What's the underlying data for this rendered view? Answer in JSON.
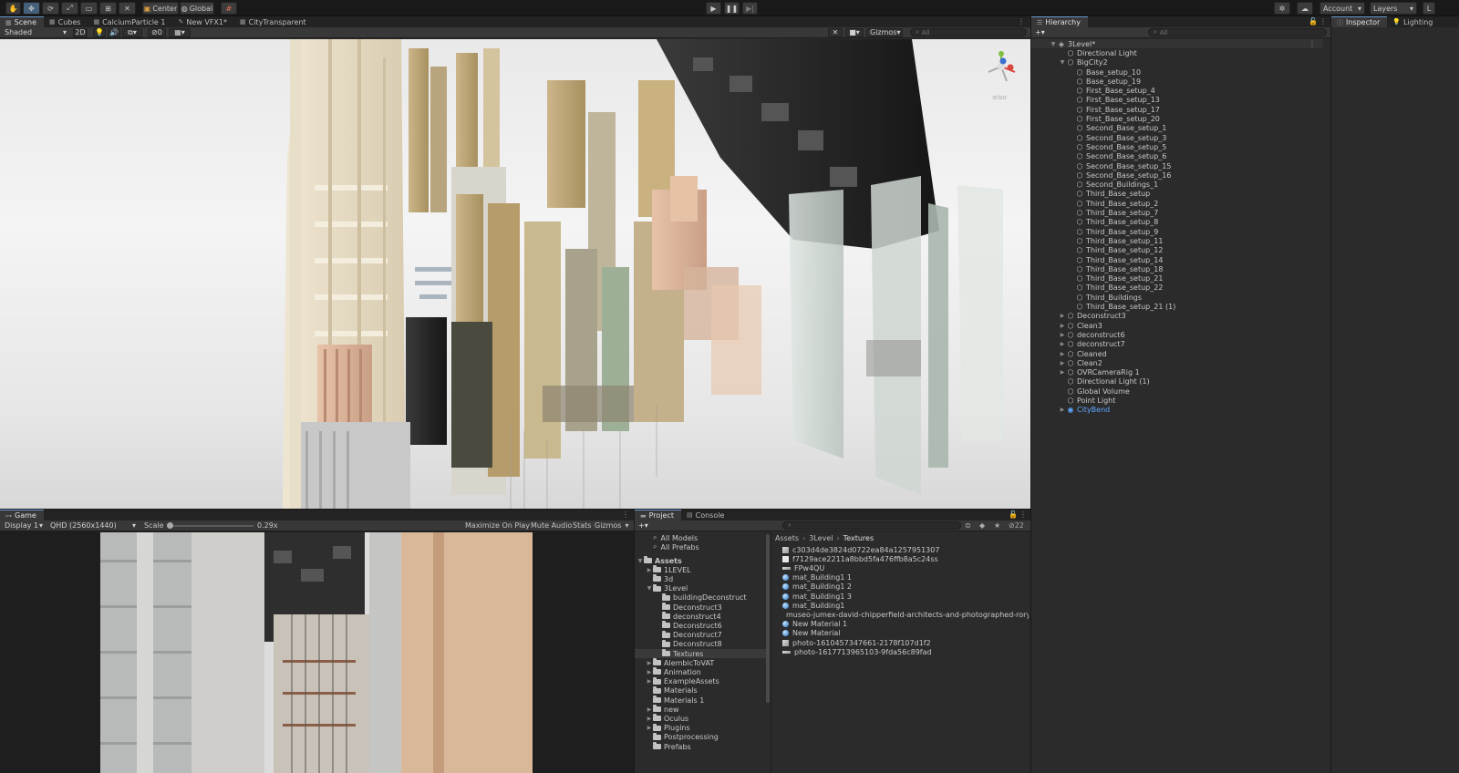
{
  "toolbar": {
    "center_label": "Center",
    "global_label": "Global",
    "account_label": "Account",
    "layers_label": "Layers"
  },
  "scene": {
    "tabs": [
      {
        "label": "Scene"
      },
      {
        "label": "Cubes"
      },
      {
        "label": "CalciumParticle 1"
      },
      {
        "label": "New VFX1*"
      },
      {
        "label": "CityTransparent"
      }
    ],
    "shading": "Shaded",
    "mode_2d": "2D",
    "gizmos": "Gizmos",
    "search_placeholder": "All",
    "fx_count": "0",
    "persp_label": "≡Iso"
  },
  "game": {
    "tab": "Game",
    "display": "Display 1",
    "resolution": "QHD (2560x1440)",
    "scale_label": "Scale",
    "scale_value": "0.29x",
    "maximize": "Maximize On Play",
    "mute": "Mute Audio",
    "stats": "Stats",
    "gizmos": "Gizmos"
  },
  "hierarchy": {
    "tab": "Hierarchy",
    "search_placeholder": "All",
    "root": "3Level*",
    "items": [
      {
        "label": "Directional Light",
        "indent": 1
      },
      {
        "label": "BigCity2",
        "indent": 1,
        "expanded": true
      },
      {
        "label": "Base_setup_10",
        "indent": 2
      },
      {
        "label": "Base_setup_19",
        "indent": 2
      },
      {
        "label": "First_Base_setup_4",
        "indent": 2
      },
      {
        "label": "First_Base_setup_13",
        "indent": 2
      },
      {
        "label": "First_Base_setup_17",
        "indent": 2
      },
      {
        "label": "First_Base_setup_20",
        "indent": 2
      },
      {
        "label": "Second_Base_setup_1",
        "indent": 2
      },
      {
        "label": "Second_Base_setup_3",
        "indent": 2
      },
      {
        "label": "Second_Base_setup_5",
        "indent": 2
      },
      {
        "label": "Second_Base_setup_6",
        "indent": 2
      },
      {
        "label": "Second_Base_setup_15",
        "indent": 2
      },
      {
        "label": "Second_Base_setup_16",
        "indent": 2
      },
      {
        "label": "Second_Buildings_1",
        "indent": 2
      },
      {
        "label": "Third_Base_setup",
        "indent": 2
      },
      {
        "label": "Third_Base_setup_2",
        "indent": 2
      },
      {
        "label": "Third_Base_setup_7",
        "indent": 2
      },
      {
        "label": "Third_Base_setup_8",
        "indent": 2
      },
      {
        "label": "Third_Base_setup_9",
        "indent": 2
      },
      {
        "label": "Third_Base_setup_11",
        "indent": 2
      },
      {
        "label": "Third_Base_setup_12",
        "indent": 2
      },
      {
        "label": "Third_Base_setup_14",
        "indent": 2
      },
      {
        "label": "Third_Base_setup_18",
        "indent": 2
      },
      {
        "label": "Third_Base_setup_21",
        "indent": 2
      },
      {
        "label": "Third_Base_setup_22",
        "indent": 2
      },
      {
        "label": "Third_Buildings",
        "indent": 2
      },
      {
        "label": "Third_Base_setup_21 (1)",
        "indent": 2
      },
      {
        "label": "Deconstruct3",
        "indent": 1,
        "collapsed": true
      },
      {
        "label": "Clean3",
        "indent": 1,
        "collapsed": true
      },
      {
        "label": "deconstruct6",
        "indent": 1,
        "collapsed": true
      },
      {
        "label": "deconstruct7",
        "indent": 1,
        "collapsed": true
      },
      {
        "label": "Cleaned",
        "indent": 1,
        "collapsed": true
      },
      {
        "label": "Clean2",
        "indent": 1,
        "collapsed": true
      },
      {
        "label": "OVRCameraRig 1",
        "indent": 1,
        "collapsed": true
      },
      {
        "label": "Directional Light (1)",
        "indent": 1
      },
      {
        "label": "Global Volume",
        "indent": 1
      },
      {
        "label": "Point Light",
        "indent": 1
      },
      {
        "label": "CityBend",
        "indent": 1,
        "collapsed": true,
        "prefab": true
      }
    ]
  },
  "inspector": {
    "tab": "Inspector",
    "lighting_tab": "Lighting"
  },
  "project": {
    "tabs": [
      "Project",
      "Console"
    ],
    "count": "22",
    "breadcrumb": [
      "Assets",
      "3Level",
      "Textures"
    ],
    "favorites": [
      "All Models",
      "All Prefabs"
    ],
    "tree": [
      {
        "label": "Assets",
        "level": 0,
        "expanded": true
      },
      {
        "label": "1LEVEL",
        "level": 1,
        "arrow": true
      },
      {
        "label": "3d",
        "level": 1
      },
      {
        "label": "3Level",
        "level": 1,
        "expanded": true
      },
      {
        "label": "buildingDeconstruct",
        "level": 2
      },
      {
        "label": "Deconstruct3",
        "level": 2
      },
      {
        "label": "deconstruct4",
        "level": 2
      },
      {
        "label": "Deconstruct6",
        "level": 2
      },
      {
        "label": "Deconstruct7",
        "level": 2
      },
      {
        "label": "Deconstruct8",
        "level": 2
      },
      {
        "label": "Textures",
        "level": 2,
        "selected": true
      },
      {
        "label": "AlembicToVAT",
        "level": 1,
        "arrow": true
      },
      {
        "label": "Animation",
        "level": 1,
        "arrow": true
      },
      {
        "label": "ExampleAssets",
        "level": 1,
        "arrow": true
      },
      {
        "label": "Materials",
        "level": 1
      },
      {
        "label": "Materials 1",
        "level": 1
      },
      {
        "label": "new",
        "level": 1,
        "arrow": true
      },
      {
        "label": "Oculus",
        "level": 1,
        "arrow": true
      },
      {
        "label": "Plugins",
        "level": 1,
        "arrow": true
      },
      {
        "label": "Postprocessing",
        "level": 1
      },
      {
        "label": "Prefabs",
        "level": 1
      }
    ],
    "assets": [
      {
        "label": "c303d4de3824d0722ea84a1257951307",
        "type": "texture"
      },
      {
        "label": "f7129ace2211a8bbd5fa476ffb8a5c24ss",
        "type": "file"
      },
      {
        "label": "FPw4QU",
        "type": "texture-strip"
      },
      {
        "label": "mat_Building1 1",
        "type": "material"
      },
      {
        "label": "mat_Building1 2",
        "type": "material"
      },
      {
        "label": "mat_Building1 3",
        "type": "material"
      },
      {
        "label": "mat_Building1",
        "type": "material"
      },
      {
        "label": "museo-jumex-david-chipperfield-architects-and-photographed-rory-ga",
        "type": "texture-strip"
      },
      {
        "label": "New Material 1",
        "type": "material"
      },
      {
        "label": "New Material",
        "type": "material"
      },
      {
        "label": "photo-1610457347661-2178f107d1f2",
        "type": "texture"
      },
      {
        "label": "photo-1617713965103-9fda56c89fad",
        "type": "texture-strip"
      }
    ]
  },
  "colors": {
    "accent": "#4d7fc4",
    "selection": "#3e5f8a",
    "prefab_blue": "#5fa8ff"
  }
}
